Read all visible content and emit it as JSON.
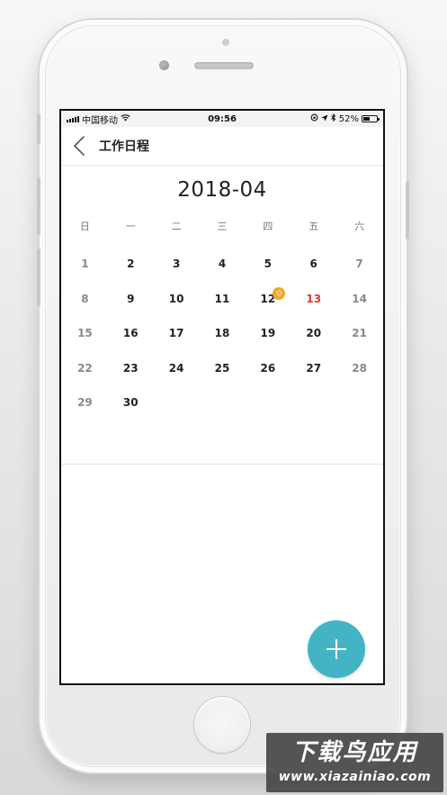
{
  "status_bar": {
    "carrier": "中国移动",
    "time": "09:56",
    "battery_text": "52%",
    "battery_level": 0.52
  },
  "nav": {
    "title": "工作日程",
    "back_icon": "chevron-left-icon"
  },
  "calendar": {
    "month": "2018-04",
    "weekdays": [
      "日",
      "一",
      "二",
      "三",
      "四",
      "五",
      "六"
    ],
    "weeks": [
      [
        "1",
        "2",
        "3",
        "4",
        "5",
        "6",
        "7"
      ],
      [
        "8",
        "9",
        "10",
        "11",
        "12",
        "13",
        "14"
      ],
      [
        "15",
        "16",
        "17",
        "18",
        "19",
        "20",
        "21"
      ],
      [
        "22",
        "23",
        "24",
        "25",
        "26",
        "27",
        "28"
      ],
      [
        "29",
        "30",
        "",
        "",
        "",
        "",
        ""
      ]
    ],
    "today": "13",
    "badge_day": "12",
    "badge_icon": "smiley-icon"
  },
  "fab": {
    "icon": "plus-icon",
    "color": "#43b4c4"
  },
  "colors": {
    "today_text": "#d93a2f",
    "badge": "#f2a626"
  },
  "watermark": {
    "title": "下载鸟应用",
    "url": "www.xiazainiao.com"
  }
}
